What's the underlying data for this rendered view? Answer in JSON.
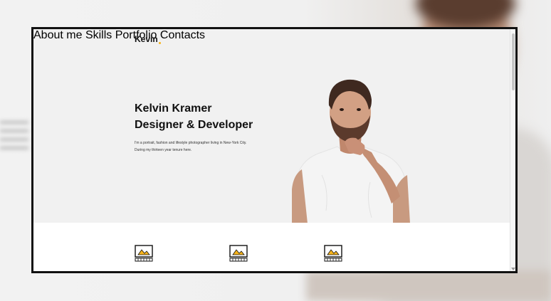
{
  "site": {
    "logo": "Kevin",
    "nav": [
      "About me",
      "Skills",
      "Portfolio",
      "Contacts"
    ]
  },
  "hero": {
    "title_line1": "Kelvin Kramer",
    "title_line2": "Designer & Developer",
    "desc_line1": "I'm a portrait, fashion and lifestyle photographer living in New-York City.",
    "desc_line2": "During my thirteen year tenure here."
  },
  "colors": {
    "accent": "#f6b31b",
    "text": "#111111",
    "page_bg": "#f1f1f1"
  },
  "features": [
    {
      "icon": "image-frame-icon"
    },
    {
      "icon": "image-frame-icon"
    },
    {
      "icon": "image-frame-icon"
    }
  ]
}
